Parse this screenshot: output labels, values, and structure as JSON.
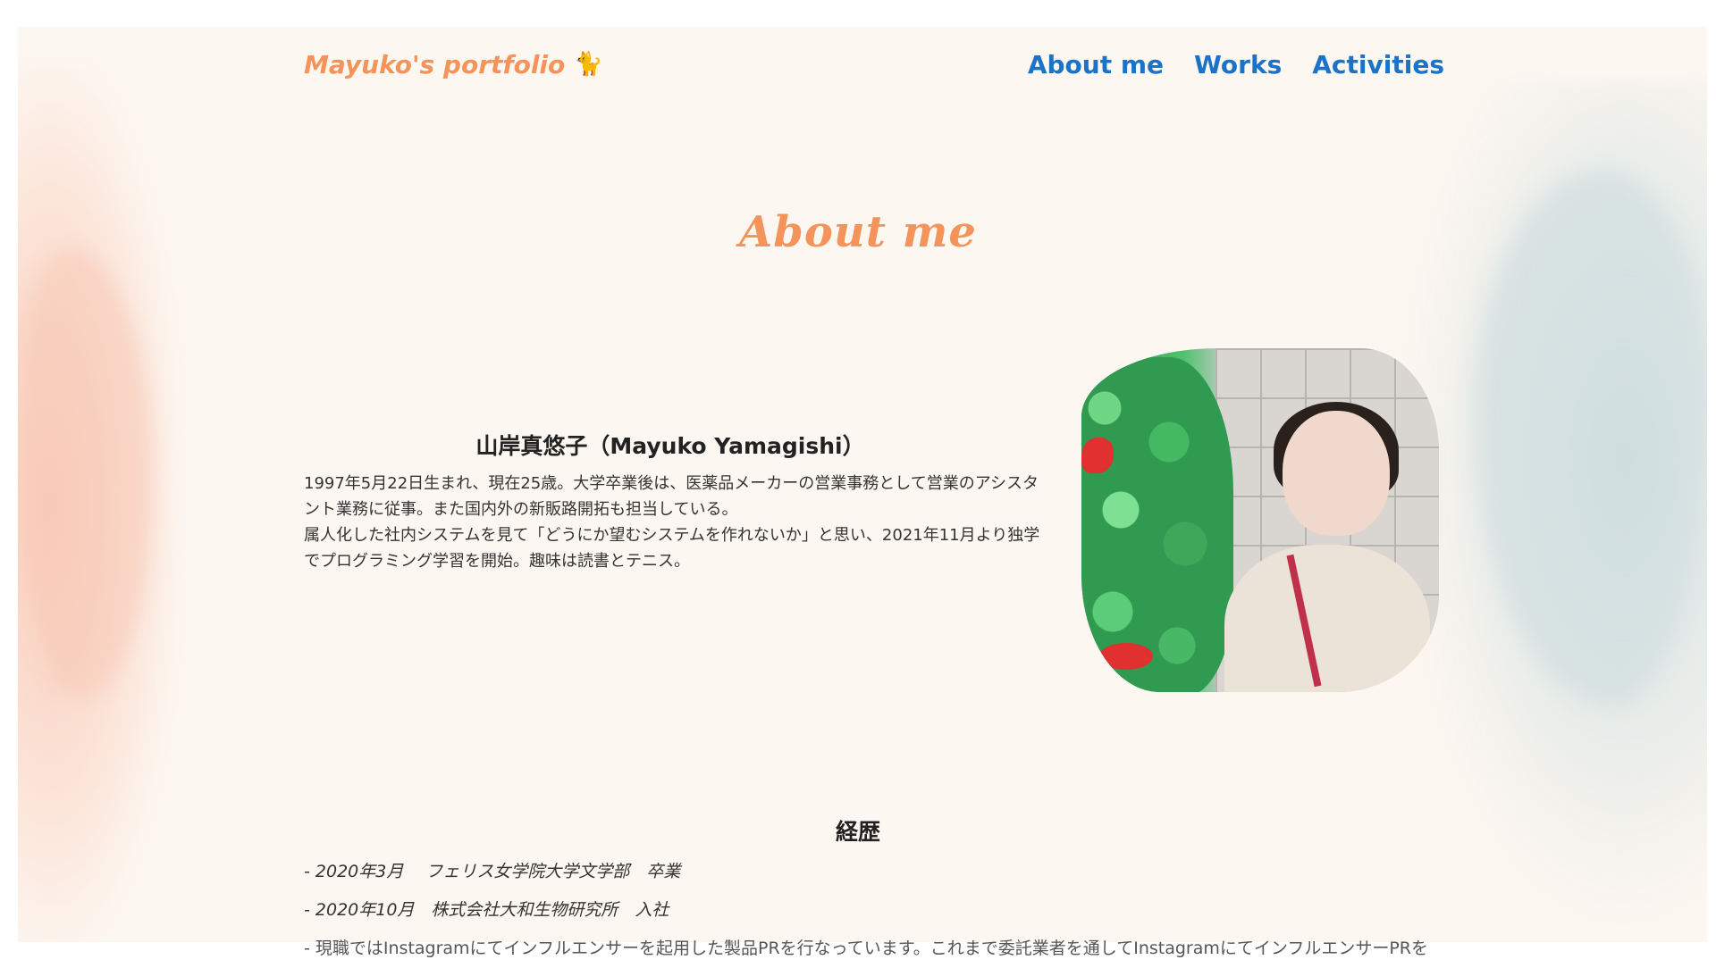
{
  "header": {
    "logo": "Mayuko's portfolio",
    "logo_icon": "cat-icon",
    "nav": [
      "About me",
      "Works",
      "Activities"
    ]
  },
  "about": {
    "title": "About me",
    "name": "山岸真悠子（Mayuko Yamagishi）",
    "paragraphs": [
      "1997年5月22日生まれ、現在25歳。大学卒業後は、医薬品メーカーの営業事務として営業のアシスタント業務に従事。また国内外の新販路開拓も担当している。",
      "属人化した社内システムを見て「どうにか望むシステムを作れないか」と思い、2021年11月より独学でプログラミング学習を開始。趣味は読書とテニス。"
    ]
  },
  "career": {
    "title": "経歴",
    "items": [
      "- 2020年3月　 フェリス女学院大学文学部　卒業",
      "- 2020年10月　株式会社大和生物研究所　入社",
      "- 現職ではInstagramにてインフルエンサーを起用した製品PRを行なっています。これまで委託業者を通してInstagramにてインフルエンサーPRを"
    ]
  },
  "colors": {
    "accent": "#f4935a",
    "nav": "#1a72c9",
    "background": "#fdf7f1"
  }
}
